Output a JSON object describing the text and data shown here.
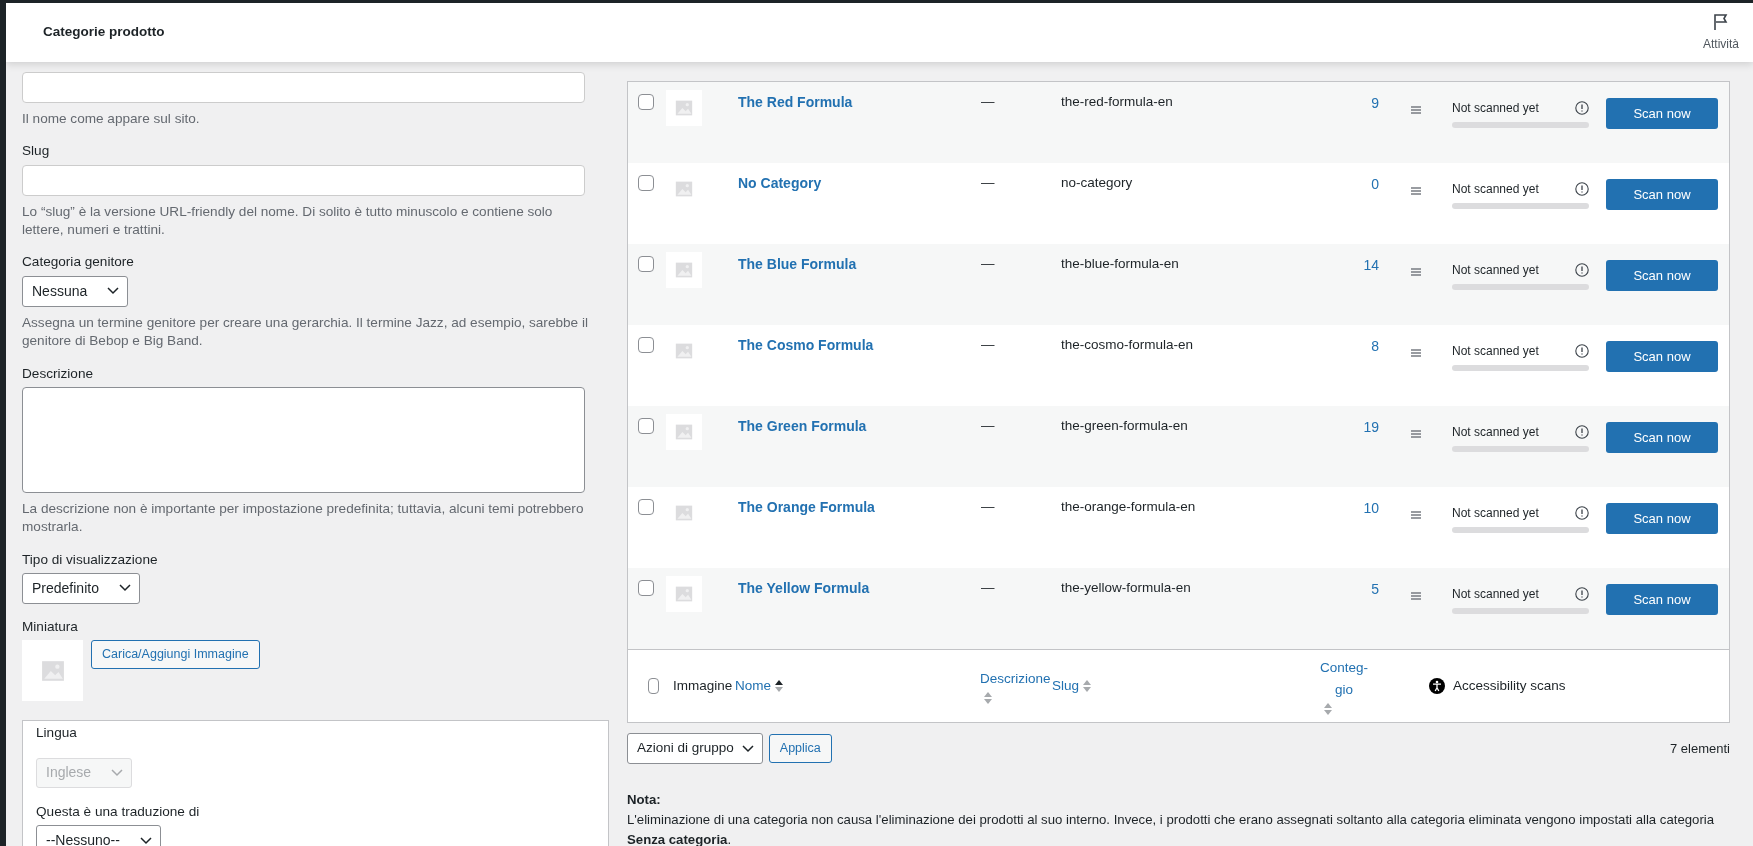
{
  "header": {
    "title": "Categorie prodotto",
    "activity_label": "Attività"
  },
  "form": {
    "fields": [
      {
        "kind": "text",
        "hint": "Il nome come appare sul sito."
      },
      {
        "kind": "text",
        "label": "Slug",
        "hint": "Lo “slug” è la versione URL-friendly del nome. Di solito è tutto minuscolo e contiene solo lettere, numeri e trattini."
      },
      {
        "kind": "select",
        "label": "Categoria genitore",
        "value": "Nessuna",
        "hint": "Assegna un termine genitore per creare una gerarchia. Il termine Jazz, ad esempio, sarebbe il genitore di Bebop e Big Band."
      },
      {
        "kind": "textarea",
        "label": "Descrizione",
        "hint": "La descrizione non è importante per impostazione predefinita; tuttavia, alcuni temi potrebbero mostrarla."
      },
      {
        "kind": "select",
        "label": "Tipo di visualizzazione",
        "value": "Predefinito"
      },
      {
        "kind": "thumbnail",
        "label": "Miniatura",
        "button": "Carica/Aggiungi Immagine"
      }
    ],
    "language_box": {
      "label": "Lingua",
      "value": "Inglese",
      "disabled": true,
      "translation_label": "Questa è una traduzione di",
      "translation_value": "--Nessuno--"
    }
  },
  "table": {
    "rows": [
      {
        "checked": false,
        "name": "The Red Formula",
        "description": "—",
        "slug": "the-red-formula-en",
        "count": "9",
        "scan_status": "Not scanned yet",
        "level": 0,
        "button": "Scan now"
      },
      {
        "checked": false,
        "name": "No Category",
        "description": "—",
        "slug": "no-category",
        "count": "0",
        "scan_status": "Not scanned yet",
        "level": 0,
        "button": "Scan now"
      },
      {
        "checked": false,
        "name": "The Blue Formula",
        "description": "—",
        "slug": "the-blue-formula-en",
        "count": "14",
        "scan_status": "Not scanned yet",
        "level": 0,
        "button": "Scan now"
      },
      {
        "checked": false,
        "name": "The Cosmo Formula",
        "description": "—",
        "slug": "the-cosmo-formula-en",
        "count": "8",
        "scan_status": "Not scanned yet",
        "level": 0,
        "button": "Scan now"
      },
      {
        "checked": false,
        "name": "The Green Formula",
        "description": "—",
        "slug": "the-green-formula-en",
        "count": "19",
        "scan_status": "Not scanned yet",
        "level": 0,
        "button": "Scan now"
      },
      {
        "checked": false,
        "name": "The Orange Formula",
        "description": "—",
        "slug": "the-orange-formula-en",
        "count": "10",
        "scan_status": "Not scanned yet",
        "level": 0,
        "button": "Scan now"
      },
      {
        "checked": false,
        "name": "The Yellow Formula",
        "description": "—",
        "slug": "the-yellow-formula-en",
        "count": "5",
        "scan_status": "Not scanned yet",
        "level": 0,
        "button": "Scan now"
      }
    ],
    "footer": {
      "checked": false,
      "columns": [
        {
          "kind": "plain",
          "label": "Immagine"
        },
        {
          "kind": "sortable",
          "label": "Nome",
          "sorted": true
        },
        {
          "kind": "sortable",
          "label": "Descrizione",
          "sorted": false
        },
        {
          "kind": "sortable",
          "label": "Slug",
          "sorted": false
        },
        {
          "kind": "sortable",
          "label": "Conteg-gio",
          "sorted": false
        },
        {
          "kind": "accessibility",
          "label": "Accessibility scans"
        }
      ]
    }
  },
  "bulk": {
    "action": "Azioni di gruppo",
    "apply": "Applica",
    "count": "7 elementi"
  },
  "note": {
    "title": "Nota:",
    "text": "L'eliminazione di una categoria non causa l'eliminazione dei prodotti al suo interno. Invece, i prodotti che erano assegnati soltanto alla categoria eliminata vengono impostati alla categoria **Senza categoria**."
  }
}
